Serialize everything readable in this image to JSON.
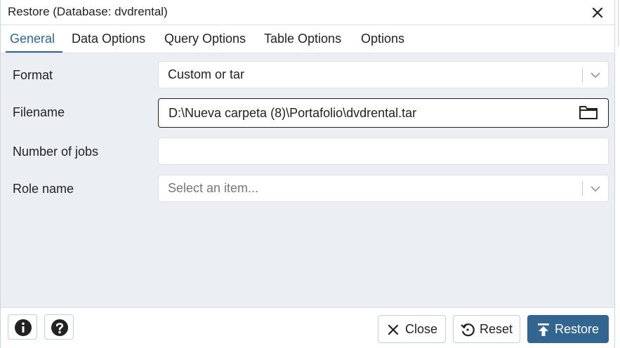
{
  "window": {
    "title": "Restore (Database: dvdrental)"
  },
  "tabs": [
    {
      "label": "General",
      "active": true
    },
    {
      "label": "Data Options"
    },
    {
      "label": "Query Options"
    },
    {
      "label": "Table Options"
    },
    {
      "label": "Options"
    }
  ],
  "form": {
    "format": {
      "label": "Format",
      "value": "Custom or tar"
    },
    "filename": {
      "label": "Filename",
      "value": "D:\\Nueva carpeta (8)\\Portafolio\\dvdrental.tar"
    },
    "jobs": {
      "label": "Number of jobs",
      "value": ""
    },
    "role": {
      "label": "Role name",
      "placeholder": "Select an item..."
    }
  },
  "footer": {
    "close_label": "Close",
    "reset_label": "Reset",
    "restore_label": "Restore"
  },
  "colors": {
    "accent": "#2f6596",
    "primary_button": "#326690",
    "body_bg": "#ebeef3"
  },
  "icons": [
    "close-icon",
    "chevron-down-icon",
    "folder-icon",
    "info-icon",
    "help-icon",
    "reset-icon",
    "upload-icon"
  ]
}
